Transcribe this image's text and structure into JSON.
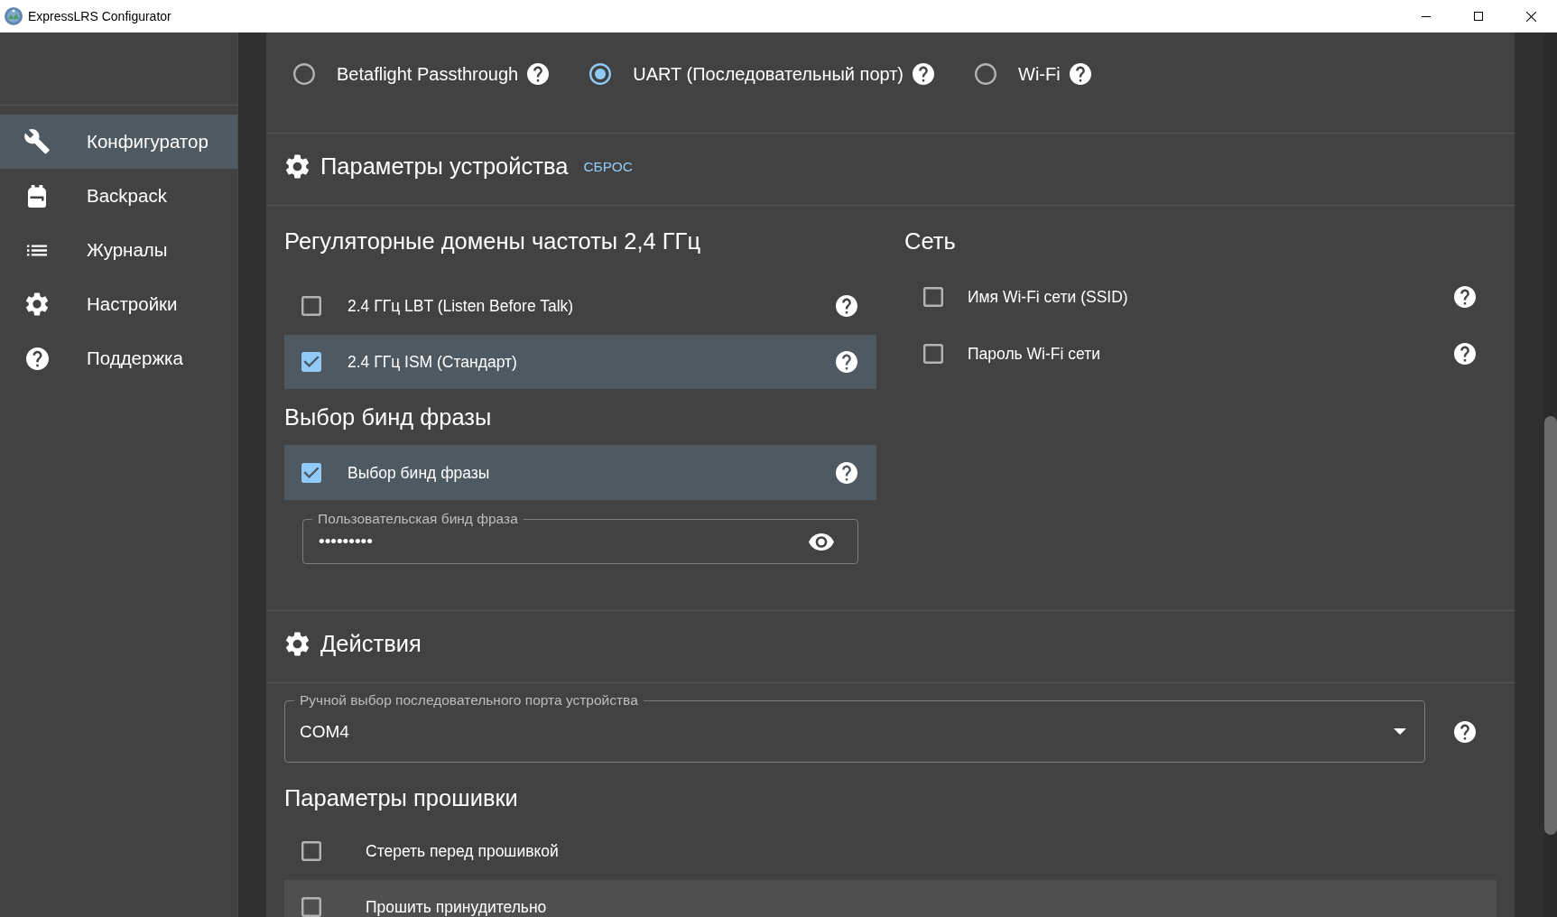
{
  "window": {
    "title": "ExpressLRS Configurator"
  },
  "sidebar": {
    "items": [
      {
        "label": "Конфигуратор",
        "selected": true
      },
      {
        "label": "Backpack",
        "selected": false
      },
      {
        "label": "Журналы",
        "selected": false
      },
      {
        "label": "Настройки",
        "selected": false
      },
      {
        "label": "Поддержка",
        "selected": false
      }
    ]
  },
  "flashing_methods": [
    {
      "label": "Betaflight Passthrough",
      "selected": false
    },
    {
      "label": "UART (Последовательный порт)",
      "selected": true
    },
    {
      "label": "Wi-Fi",
      "selected": false
    }
  ],
  "device_options": {
    "title": "Параметры устройства",
    "reset": "СБРОС",
    "regulatory_domains": {
      "title": "Регуляторные домены частоты 2,4 ГГц",
      "items": [
        {
          "label": "2.4 ГГц LBT (Listen Before Talk)",
          "checked": false
        },
        {
          "label": "2.4 ГГц ISM (Стандарт)",
          "checked": true
        }
      ]
    },
    "binding_phrase": {
      "title": "Выбор бинд фразы",
      "items": [
        {
          "label": "Выбор бинд фразы",
          "checked": true
        }
      ],
      "field": {
        "label": "Пользовательская бинд фраза",
        "value": "•••••••••"
      }
    },
    "network": {
      "title": "Сеть",
      "items": [
        {
          "label": "Имя Wi-Fi сети (SSID)",
          "checked": false
        },
        {
          "label": "Пароль Wi-Fi сети",
          "checked": false
        }
      ]
    }
  },
  "actions": {
    "title": "Действия",
    "serial_port": {
      "label": "Ручной выбор последовательного порта устройства",
      "value": "COM4"
    },
    "firmware_options": {
      "title": "Параметры прошивки",
      "items": [
        {
          "label": "Стереть перед прошивкой",
          "checked": false,
          "hovered": false
        },
        {
          "label": "Прошить принудительно",
          "checked": false,
          "hovered": true
        }
      ]
    }
  }
}
